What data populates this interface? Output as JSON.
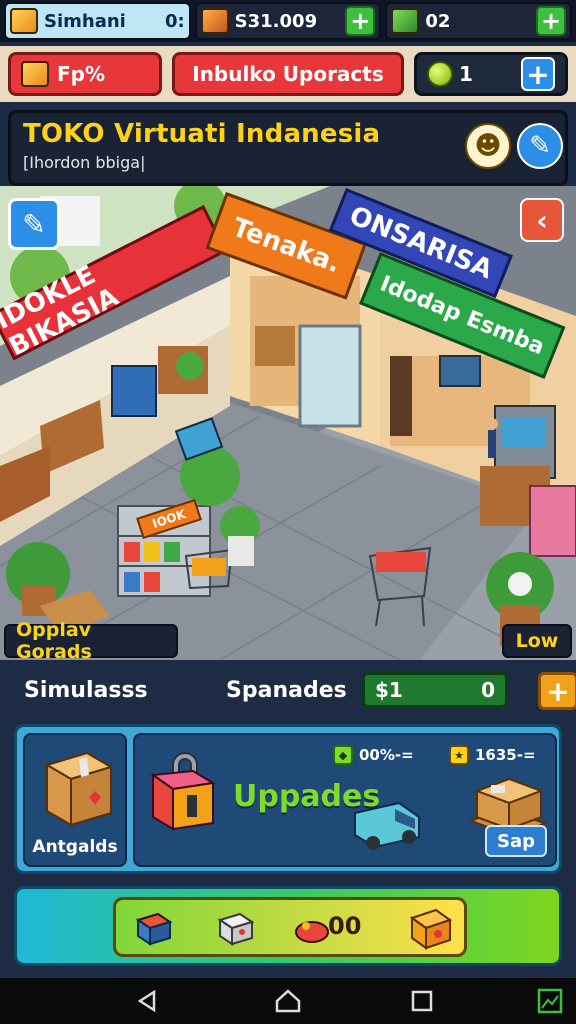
{
  "topbar": {
    "resources": [
      {
        "icon": "gold-crate-icon",
        "value": "Simhani",
        "extra": "0:"
      },
      {
        "icon": "orange-crate-icon",
        "value": "S31.009",
        "action": "+"
      },
      {
        "icon": "green-crate-icon",
        "value": "02",
        "action": "+"
      }
    ]
  },
  "row2": {
    "left_pill": {
      "icon": "box-icon",
      "label": "Fp%"
    },
    "center_pill": {
      "label": "Inbulko Uporacts"
    },
    "right_pill": {
      "icon": "coin-icon",
      "value": "1",
      "action": "+"
    }
  },
  "title_panel": {
    "title": "TOKO Virtuati Indanesia",
    "subtitle": "[Ihordon bbiga|",
    "icons": [
      "mascot-icon",
      "edit-icon"
    ]
  },
  "scene": {
    "signs": [
      {
        "text": "IDOKLE BIKASIA",
        "color": "#e8323a"
      },
      {
        "text": "Tenaka.",
        "color": "#f07a1a"
      },
      {
        "text": "ONSARISA",
        "color": "#3246b8"
      },
      {
        "text": "Idodap Esmba",
        "color": "#2aa84a"
      }
    ],
    "shelf_sign": "IOOK",
    "left_button_icon": "cursor-box-icon",
    "right_button_icon": "chevron-left-icon",
    "bottom_left_tag": "Opplav Gorads",
    "bottom_right_tag": "Low"
  },
  "bottom": {
    "stats_label": "Simulasss",
    "upgrades_label": "Spanades",
    "money_symbol": "$1",
    "money_value": "0",
    "plus": "+",
    "left_card_label": "Antgalds",
    "upgrades_title": "Uppades",
    "chip1": "00%-=",
    "chip2": "1635-=",
    "sap_label": "Sap",
    "tray_text": "00"
  },
  "colors": {
    "accent_red": "#e8373a",
    "accent_yellow": "#ffd21a",
    "accent_green": "#3fbf3f",
    "panel_blue": "#3fa8d6"
  }
}
